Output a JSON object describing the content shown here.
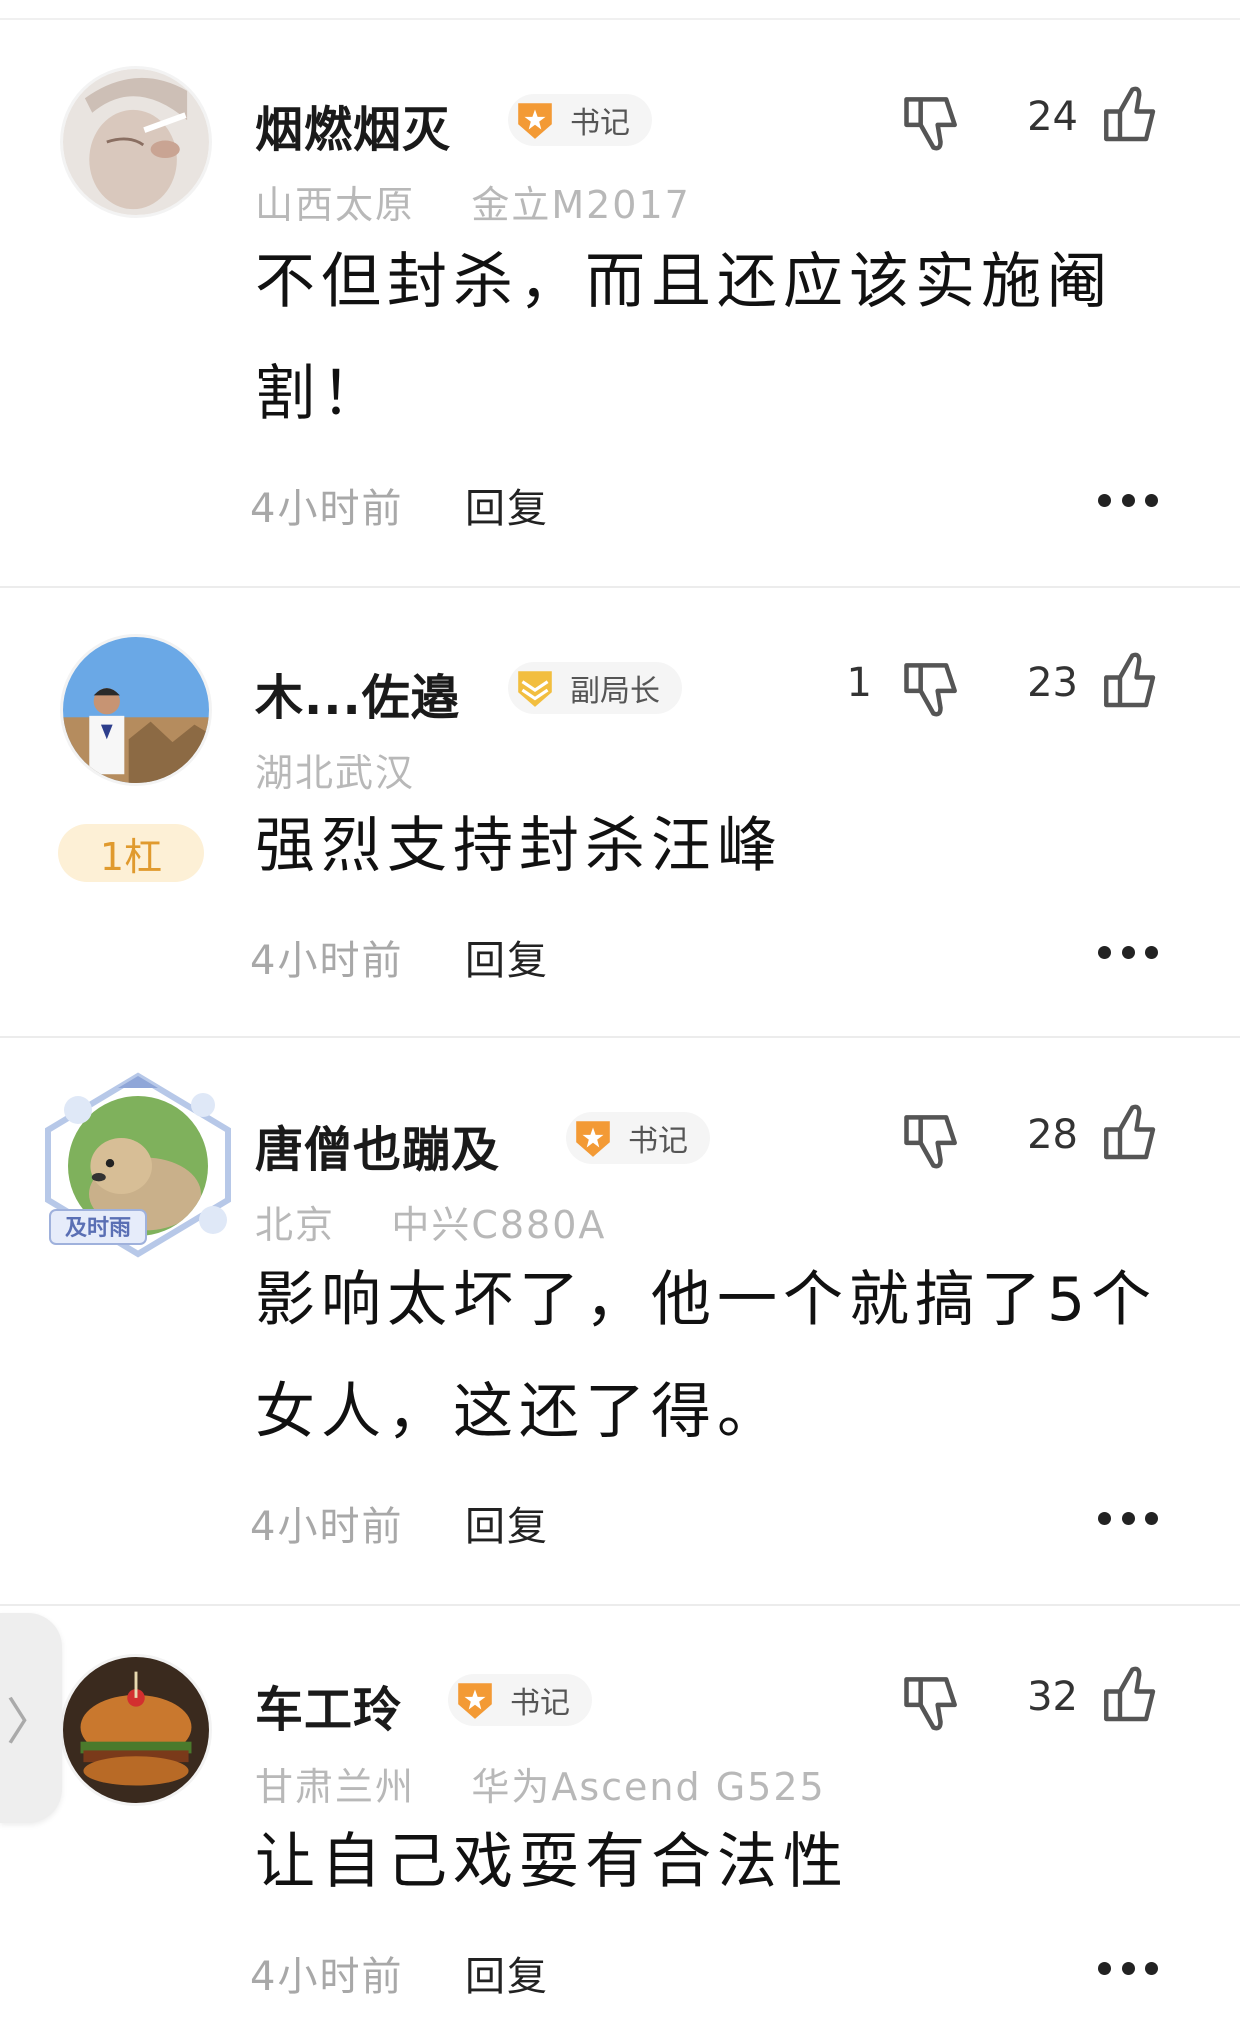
{
  "comments": [
    {
      "user": "烟燃烟灭",
      "badge": "书记",
      "location": "山西太原",
      "device": "金立M2017",
      "text": "不但封杀，而且还应该实施阉割！",
      "time": "4小时前",
      "reply_label": "回复",
      "dislikes": "",
      "likes": "24"
    },
    {
      "user": "木...佐邉",
      "badge": "副局长",
      "location": "湖北武汉",
      "device": "",
      "floor": "1杠",
      "text": "强烈支持封杀汪峰",
      "time": "4小时前",
      "reply_label": "回复",
      "dislikes": "1",
      "likes": "23"
    },
    {
      "user": "唐僧也蹦及",
      "badge": "书记",
      "avatar_frame_label": "及时雨",
      "location": "北京",
      "device": "中兴C880A",
      "text": "影响太坏了，他一个就搞了5个女人，这还了得。",
      "time": "4小时前",
      "reply_label": "回复",
      "dislikes": "",
      "likes": "28"
    },
    {
      "user": "车工玲",
      "badge": "书记",
      "location": "甘肃兰州",
      "device": "华为Ascend G525",
      "text": "让自己戏耍有合法性",
      "time": "4小时前",
      "reply_label": "回复",
      "dislikes": "",
      "likes": "32"
    }
  ],
  "side_tab_glyph": "〉",
  "colors": {
    "badge_orange": "#f39a35",
    "badge_gold": "#f2be3f",
    "floor_bg": "#fdf0d6",
    "floor_text": "#e09a2e",
    "meta_gray": "#b8b8b8"
  },
  "icons": [
    "thumbs-down-icon",
    "thumbs-up-icon",
    "more-dots-icon",
    "badge-star-icon",
    "chevron-right-icon"
  ]
}
